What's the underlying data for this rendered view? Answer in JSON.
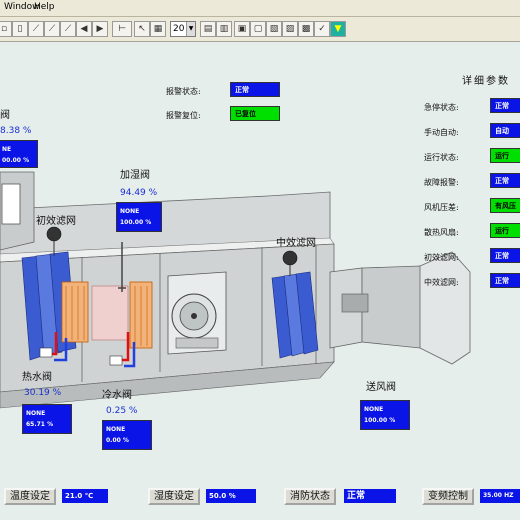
{
  "menu": {
    "window": "Window",
    "help": "Help"
  },
  "toolbar": {
    "zoom_value": "20"
  },
  "alarm": {
    "status_label": "报警状态:",
    "status_value": "正常",
    "reset_label": "报警复位:",
    "reset_value": "已复位"
  },
  "params": {
    "title": "详细参数",
    "rows": [
      {
        "label": "急停状态:",
        "value": "正常",
        "color": "blue"
      },
      {
        "label": "手动自动:",
        "value": "自动",
        "color": "blue"
      },
      {
        "label": "运行状态:",
        "value": "运行",
        "color": "green"
      },
      {
        "label": "故障报警:",
        "value": "正常",
        "color": "blue"
      },
      {
        "label": "风机压差:",
        "value": "有风压",
        "color": "green"
      },
      {
        "label": "散热风扇:",
        "value": "运行",
        "color": "green"
      },
      {
        "label": "初效滤网:",
        "value": "正常",
        "color": "blue"
      },
      {
        "label": "中效滤网:",
        "value": "正常",
        "color": "blue"
      }
    ]
  },
  "fresh_valve": {
    "label": "阀",
    "pct": "8.38 %",
    "box_line1": "NE",
    "box_line2": "00.00 %"
  },
  "primary_filter": {
    "label": "初效滤网"
  },
  "humid_valve": {
    "label": "加湿阀",
    "pct": "94.49 %",
    "box_line1": "NONE",
    "box_line2": "100.00 %"
  },
  "mid_filter": {
    "label": "中效滤网"
  },
  "hot_valve": {
    "label": "热水阀",
    "pct": "30.19 %",
    "box_line1": "NONE",
    "box_line2": "65.71 %"
  },
  "cold_valve": {
    "label": "冷水阀",
    "pct": "0.25 %",
    "box_line1": "NONE",
    "box_line2": "0.00 %"
  },
  "supply_valve": {
    "label": "送风阀",
    "box_line1": "NONE",
    "box_line2": "100.00 %"
  },
  "bottom": {
    "temp_label": "温度设定",
    "temp_value": "21.0 ℃",
    "humid_label": "湿度设定",
    "humid_value": "50.0 %",
    "fire_label": "消防状态",
    "fire_value": "正常",
    "vfd_label": "变频控制",
    "vfd_value": "35.00 HZ"
  },
  "colors": {
    "blue": "#0a14e6",
    "green": "#00e000",
    "pct_text": "#1a2fd0"
  }
}
